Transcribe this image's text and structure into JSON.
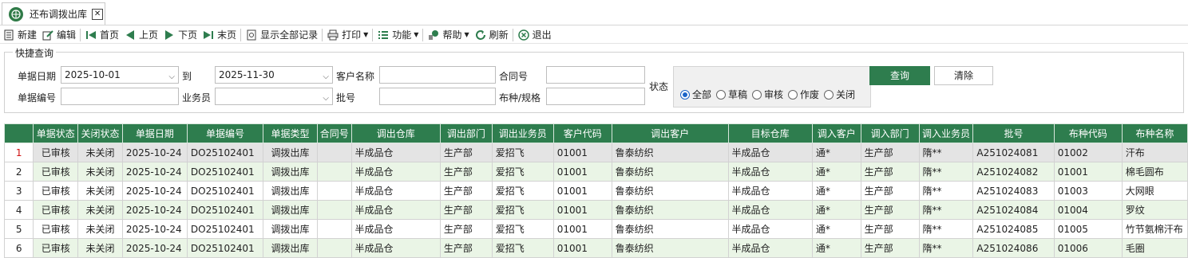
{
  "tab": {
    "title": "还布调拨出库",
    "close": "✕"
  },
  "toolbar": {
    "new": "新建",
    "edit": "编辑",
    "first": "首页",
    "prev": "上页",
    "next": "下页",
    "last": "末页",
    "show_all": "显示全部记录",
    "print": "打印",
    "func": "功能",
    "help": "帮助",
    "refresh": "刷新",
    "exit": "退出"
  },
  "quick": {
    "title": "快捷查询",
    "date_label": "单据日期",
    "date_from": "2025-10-01",
    "to_label": "到",
    "date_to": "2025-11-30",
    "customer_label": "客户名称",
    "customer_value": "",
    "contract_label": "合同号",
    "contract_value": "",
    "docno_label": "单据编号",
    "docno_value": "",
    "staff_label": "业务员",
    "staff_value": "",
    "batch_label": "批号",
    "batch_value": "",
    "fabric_label": "布种/规格",
    "fabric_value": "",
    "status_label": "状态",
    "status_options": [
      "全部",
      "草稿",
      "审核",
      "作废",
      "关闭"
    ],
    "status_selected": "全部",
    "query": "查询",
    "clear": "清除"
  },
  "grid": {
    "headers": [
      "",
      "单据状态",
      "关闭状态",
      "单据日期",
      "单据编号",
      "单据类型",
      "合同号",
      "调出仓库",
      "调出部门",
      "调出业务员",
      "客户代码",
      "调出客户",
      "目标仓库",
      "调入客户",
      "调入部门",
      "调入业务员",
      "批号",
      "布种代码",
      "布种名称"
    ],
    "rows": [
      [
        "1",
        "已审核",
        "未关闭",
        "2025-10-24",
        "DO25102401",
        "调拨出库",
        "",
        "半成品仓",
        "生产部",
        "爱招飞",
        "01001",
        "鲁泰纺织",
        "半成品仓",
        "通*",
        "生产部",
        "隋**",
        "A251024081",
        "01002",
        "汗布"
      ],
      [
        "2",
        "已审核",
        "未关闭",
        "2025-10-24",
        "DO25102401",
        "调拨出库",
        "",
        "半成品仓",
        "生产部",
        "爱招飞",
        "01001",
        "鲁泰纺织",
        "半成品仓",
        "通*",
        "生产部",
        "隋**",
        "A251024082",
        "01001",
        "棉毛圆布"
      ],
      [
        "3",
        "已审核",
        "未关闭",
        "2025-10-24",
        "DO25102401",
        "调拨出库",
        "",
        "半成品仓",
        "生产部",
        "爱招飞",
        "01001",
        "鲁泰纺织",
        "半成品仓",
        "通*",
        "生产部",
        "隋**",
        "A251024083",
        "01003",
        "大网眼"
      ],
      [
        "4",
        "已审核",
        "未关闭",
        "2025-10-24",
        "DO25102401",
        "调拨出库",
        "",
        "半成品仓",
        "生产部",
        "爱招飞",
        "01001",
        "鲁泰纺织",
        "半成品仓",
        "通*",
        "生产部",
        "隋**",
        "A251024084",
        "01004",
        "罗纹"
      ],
      [
        "5",
        "已审核",
        "未关闭",
        "2025-10-24",
        "DO25102401",
        "调拨出库",
        "",
        "半成品仓",
        "生产部",
        "爱招飞",
        "01001",
        "鲁泰纺织",
        "半成品仓",
        "通*",
        "生产部",
        "隋**",
        "A251024085",
        "01005",
        "竹节氨棉汗布"
      ],
      [
        "6",
        "已审核",
        "未关闭",
        "2025-10-24",
        "DO25102401",
        "调拨出库",
        "",
        "半成品仓",
        "生产部",
        "爱招飞",
        "01001",
        "鲁泰纺织",
        "半成品仓",
        "通*",
        "生产部",
        "隋**",
        "A251024086",
        "01006",
        "毛圈"
      ]
    ]
  }
}
